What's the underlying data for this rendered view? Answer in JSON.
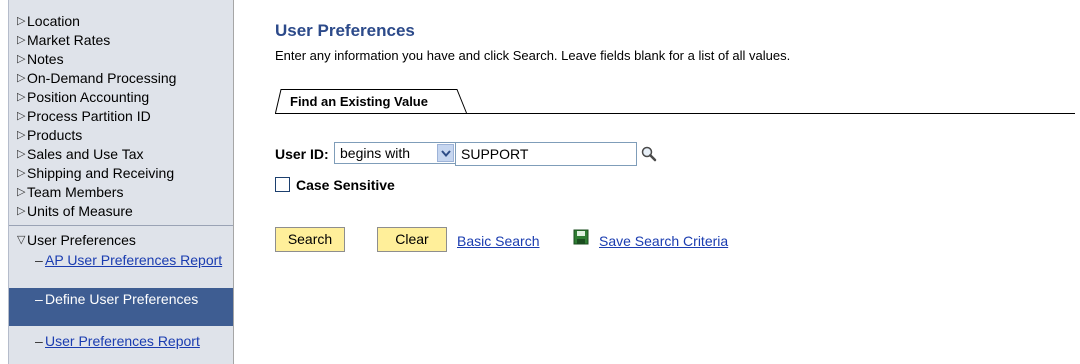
{
  "sidebar": {
    "items": [
      {
        "label": "Location"
      },
      {
        "label": "Market Rates"
      },
      {
        "label": "Notes"
      },
      {
        "label": "On-Demand Processing"
      },
      {
        "label": "Position Accounting"
      },
      {
        "label": "Process Partition ID"
      },
      {
        "label": "Products"
      },
      {
        "label": "Sales and Use Tax"
      },
      {
        "label": "Shipping and Receiving"
      },
      {
        "label": "Team Members"
      },
      {
        "label": "Units of Measure"
      }
    ],
    "expanded": {
      "label": "User Preferences",
      "children": [
        {
          "label": "AP User Preferences Report",
          "selected": false
        },
        {
          "label": "Define User Preferences",
          "selected": true
        },
        {
          "label": "User Preferences Report",
          "selected": false
        }
      ]
    },
    "collapsed_glyph": "▷",
    "expanded_glyph": "▽",
    "child_glyph": "–"
  },
  "main": {
    "title": "User Preferences",
    "instructions": "Enter any information you have and click Search. Leave fields blank for a list of all values.",
    "tab_label": "Find an Existing Value",
    "userid_label": "User ID:",
    "operator_value": "begins with",
    "userid_value": "SUPPORT",
    "case_sensitive_label": "Case Sensitive",
    "case_sensitive_checked": false,
    "search_button": "Search",
    "clear_button": "Clear",
    "basic_search_link": "Basic Search",
    "save_criteria_link": "Save Search Criteria"
  },
  "colors": {
    "title": "#2c4a8a",
    "link": "#1a3cb0",
    "button_bg": "#ffef9a",
    "sidebar_bg": "#dfe3ea",
    "selected_bg": "#3e5d92"
  },
  "icons": {
    "lookup": "magnifier-icon",
    "save": "floppy-disk-icon",
    "dropdown": "chevron-down-icon"
  }
}
